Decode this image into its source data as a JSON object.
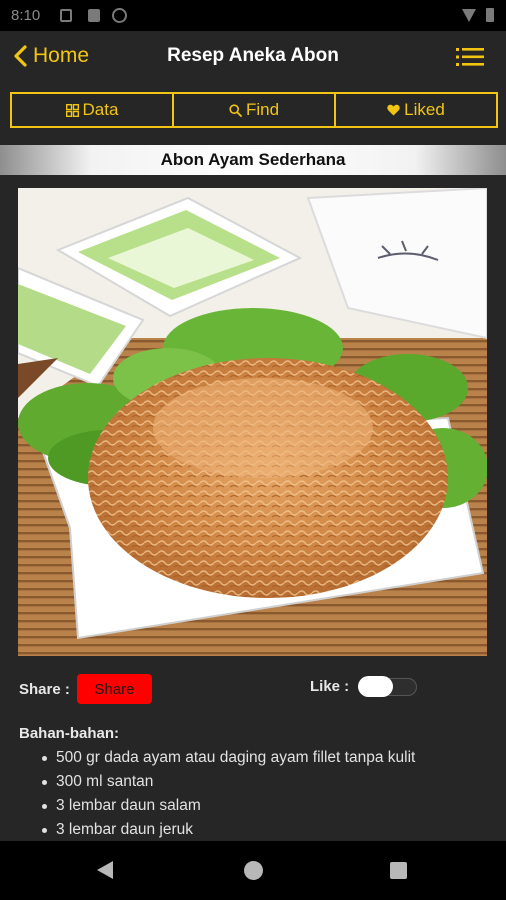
{
  "status_bar": {
    "time": "8:10"
  },
  "app_bar": {
    "back_label": "Home",
    "title": "Resep Aneka Abon"
  },
  "tabs": [
    {
      "label": "Data",
      "icon": "grid-icon"
    },
    {
      "label": "Find",
      "icon": "search-icon"
    },
    {
      "label": "Liked",
      "icon": "heart-icon"
    }
  ],
  "recipe": {
    "title": "Abon Ayam Sederhana",
    "photo": "shredded-chicken-abon-photo"
  },
  "actions": {
    "share_label": "Share :",
    "share_button": "Share",
    "like_label": "Like :",
    "like_on": false
  },
  "ingredients": {
    "heading": "Bahan-bahan:",
    "items": [
      "500 gr dada ayam atau daging ayam fillet tanpa kulit",
      "300 ml santan",
      "3 lembar daun salam",
      "3 lembar daun jeruk"
    ]
  },
  "colors": {
    "accent": "#f2c513",
    "background": "#262626",
    "share_button": "#ff0000"
  }
}
